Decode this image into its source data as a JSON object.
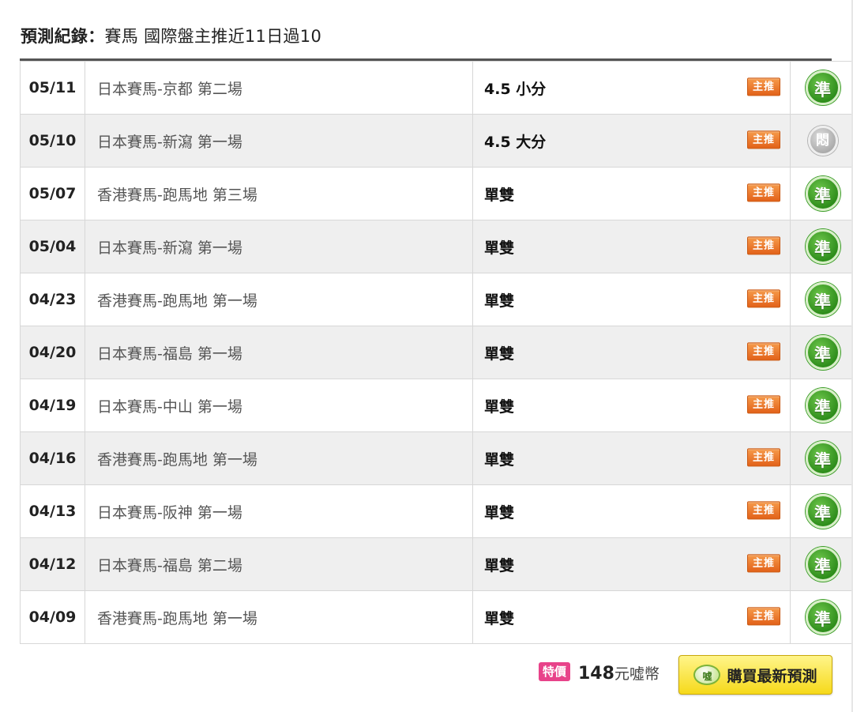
{
  "header": {
    "label": "預測紀錄：",
    "title": "賽馬 國際盤主推近11日過10"
  },
  "records": [
    {
      "date": "05/11",
      "race": "日本賽馬-京都 第二場",
      "pick": "4.5 小分",
      "badge": "主推",
      "result": "準",
      "status": "hit"
    },
    {
      "date": "05/10",
      "race": "日本賽馬-新瀉 第一場",
      "pick": "4.5 大分",
      "badge": "主推",
      "result": "悶",
      "status": "pending"
    },
    {
      "date": "05/07",
      "race": "香港賽馬-跑馬地 第三場",
      "pick": "單雙",
      "badge": "主推",
      "result": "準",
      "status": "hit"
    },
    {
      "date": "05/04",
      "race": "日本賽馬-新瀉 第一場",
      "pick": "單雙",
      "badge": "主推",
      "result": "準",
      "status": "hit"
    },
    {
      "date": "04/23",
      "race": "香港賽馬-跑馬地 第一場",
      "pick": "單雙",
      "badge": "主推",
      "result": "準",
      "status": "hit"
    },
    {
      "date": "04/20",
      "race": "日本賽馬-福島 第一場",
      "pick": "單雙",
      "badge": "主推",
      "result": "準",
      "status": "hit"
    },
    {
      "date": "04/19",
      "race": "日本賽馬-中山 第一場",
      "pick": "單雙",
      "badge": "主推",
      "result": "準",
      "status": "hit"
    },
    {
      "date": "04/16",
      "race": "香港賽馬-跑馬地 第一場",
      "pick": "單雙",
      "badge": "主推",
      "result": "準",
      "status": "hit"
    },
    {
      "date": "04/13",
      "race": "日本賽馬-阪神 第一場",
      "pick": "單雙",
      "badge": "主推",
      "result": "準",
      "status": "hit"
    },
    {
      "date": "04/12",
      "race": "日本賽馬-福島 第二場",
      "pick": "單雙",
      "badge": "主推",
      "result": "準",
      "status": "hit"
    },
    {
      "date": "04/09",
      "race": "香港賽馬-跑馬地 第一場",
      "pick": "單雙",
      "badge": "主推",
      "result": "準",
      "status": "hit"
    }
  ],
  "footer": {
    "special_tag": "特價",
    "price": "148",
    "price_unit": "元噓幣",
    "coin_label": "噓",
    "buy_label": "購買最新預測"
  },
  "colors": {
    "hit": "#2f8e1c",
    "pending": "#a9a9a9",
    "badge": "#e2621a",
    "special": "#e8438a",
    "button": "#f6d91a"
  }
}
